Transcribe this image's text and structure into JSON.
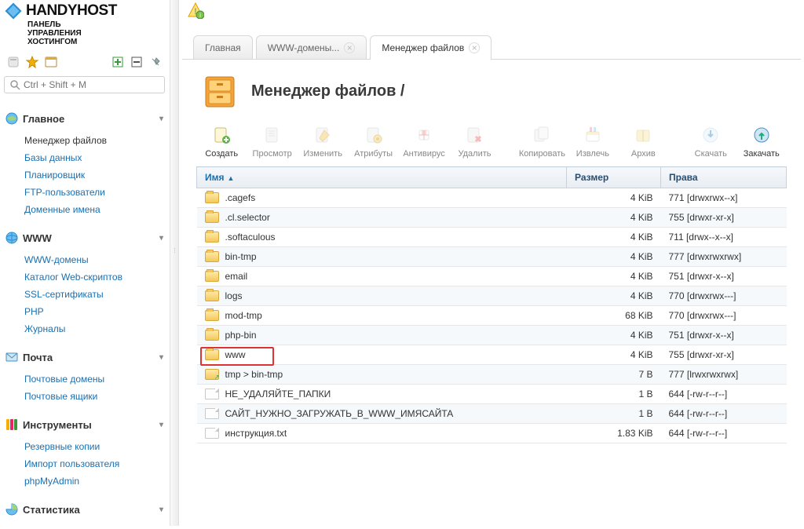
{
  "brand": {
    "name": "HANDYHOST",
    "subtitle_l1": "ПАНЕЛЬ",
    "subtitle_l2": "УПРАВЛЕНИЯ",
    "subtitle_l3": "ХОСТИНГОМ"
  },
  "search": {
    "placeholder": "Ctrl + Shift + M"
  },
  "sidebar": {
    "groups": [
      {
        "title": "Главное",
        "items": [
          "Менеджер файлов",
          "Базы данных",
          "Планировщик",
          "FTP-пользователи",
          "Доменные имена"
        ],
        "active_index": 0
      },
      {
        "title": "WWW",
        "items": [
          "WWW-домены",
          "Каталог Web-скриптов",
          "SSL-сертификаты",
          "PHP",
          "Журналы"
        ]
      },
      {
        "title": "Почта",
        "items": [
          "Почтовые домены",
          "Почтовые ящики"
        ]
      },
      {
        "title": "Инструменты",
        "items": [
          "Резервные копии",
          "Импорт пользователя",
          "phpMyAdmin"
        ]
      },
      {
        "title": "Статистика",
        "items": []
      }
    ]
  },
  "tabs": [
    {
      "label": "Главная",
      "closable": false,
      "active": false
    },
    {
      "label": "WWW-домены...",
      "closable": true,
      "active": false
    },
    {
      "label": "Менеджер файлов",
      "closable": true,
      "active": true
    }
  ],
  "page": {
    "title": "Менеджер файлов /"
  },
  "actions": [
    {
      "label": "Создать",
      "enabled": true,
      "icon": "create"
    },
    {
      "label": "Просмотр",
      "enabled": false,
      "icon": "view"
    },
    {
      "label": "Изменить",
      "enabled": false,
      "icon": "edit"
    },
    {
      "label": "Атрибуты",
      "enabled": false,
      "icon": "attrs"
    },
    {
      "label": "Антивирус",
      "enabled": false,
      "icon": "antivirus"
    },
    {
      "label": "Удалить",
      "enabled": false,
      "icon": "delete"
    },
    {
      "spacer": true
    },
    {
      "label": "Копировать",
      "enabled": false,
      "icon": "copy"
    },
    {
      "label": "Извлечь",
      "enabled": false,
      "icon": "extract"
    },
    {
      "label": "Архив",
      "enabled": false,
      "icon": "archive"
    },
    {
      "spacer": true
    },
    {
      "label": "Скачать",
      "enabled": false,
      "icon": "download"
    },
    {
      "label": "Закачать",
      "enabled": true,
      "icon": "upload"
    }
  ],
  "columns": {
    "name": "Имя",
    "size": "Размер",
    "perms": "Права"
  },
  "files": [
    {
      "type": "folder",
      "name": ".cagefs",
      "size": "4 KiB",
      "perms": "771 [drwxrwx--x]"
    },
    {
      "type": "folder",
      "name": ".cl.selector",
      "size": "4 KiB",
      "perms": "755 [drwxr-xr-x]"
    },
    {
      "type": "folder",
      "name": ".softaculous",
      "size": "4 KiB",
      "perms": "711 [drwx--x--x]"
    },
    {
      "type": "folder",
      "name": "bin-tmp",
      "size": "4 KiB",
      "perms": "777 [drwxrwxrwx]"
    },
    {
      "type": "folder",
      "name": "email",
      "size": "4 KiB",
      "perms": "751 [drwxr-x--x]"
    },
    {
      "type": "folder",
      "name": "logs",
      "size": "4 KiB",
      "perms": "770 [drwxrwx---]"
    },
    {
      "type": "folder",
      "name": "mod-tmp",
      "size": "68 KiB",
      "perms": "770 [drwxrwx---]"
    },
    {
      "type": "folder",
      "name": "php-bin",
      "size": "4 KiB",
      "perms": "751 [drwxr-x--x]"
    },
    {
      "type": "folder",
      "name": "www",
      "size": "4 KiB",
      "perms": "755 [drwxr-xr-x]",
      "highlight": true
    },
    {
      "type": "link",
      "name": "tmp > bin-tmp",
      "size": "7 B",
      "perms": "777 [lrwxrwxrwx]"
    },
    {
      "type": "file",
      "name": "НЕ_УДАЛЯЙТЕ_ПАПКИ",
      "size": "1 B",
      "perms": "644 [-rw-r--r--]"
    },
    {
      "type": "file",
      "name": "САЙТ_НУЖНО_ЗАГРУЖАТЬ_В_WWW_ИМЯСАЙТА",
      "size": "1 B",
      "perms": "644 [-rw-r--r--]"
    },
    {
      "type": "file",
      "name": "инструкция.txt",
      "size": "1.83 KiB",
      "perms": "644 [-rw-r--r--]"
    }
  ]
}
